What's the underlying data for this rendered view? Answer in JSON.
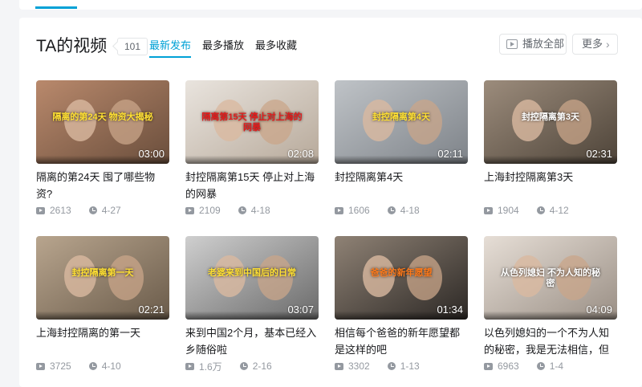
{
  "section": {
    "title": "TA的视频",
    "count": "101",
    "tabs": [
      "最新发布",
      "最多播放",
      "最多收藏"
    ],
    "active_tab": "最新发布",
    "play_all_label": "播放全部",
    "more_label": "更多"
  },
  "videos": [
    {
      "title": "隔离的第24天 囤了哪些物资?",
      "duration": "03:00",
      "views": "2613",
      "date": "4-27",
      "overlay_text": "隔离的第24天 物资大揭秘",
      "bg1": "#b9896c",
      "bg2": "#6a4e3c",
      "accent": "#ffe033"
    },
    {
      "title": "封控隔离第15天 停止对上海的网暴",
      "duration": "02:08",
      "views": "2109",
      "date": "4-18",
      "overlay_text": "隔离第15天 停止对上海的网暴",
      "bg1": "#e9e4de",
      "bg2": "#b7a99a",
      "accent": "#e21b1b"
    },
    {
      "title": "封控隔离第4天",
      "duration": "02:11",
      "views": "1606",
      "date": "4-18",
      "overlay_text": "封控隔离第4天",
      "bg1": "#bfc3c7",
      "bg2": "#7e8389",
      "accent": "#ffe033"
    },
    {
      "title": "上海封控隔离第3天",
      "duration": "02:31",
      "views": "1904",
      "date": "4-12",
      "overlay_text": "封控隔离第3天",
      "bg1": "#9c8c7c",
      "bg2": "#4e4439",
      "accent": "#ffffff"
    },
    {
      "title": "上海封控隔离的第一天",
      "duration": "02:21",
      "views": "3725",
      "date": "4-10",
      "overlay_text": "封控隔离第一天",
      "bg1": "#b8a58e",
      "bg2": "#6a5b4a",
      "accent": "#ffe033"
    },
    {
      "title": "来到中国2个月，基本已经入乡随俗啦",
      "duration": "03:07",
      "views": "1.6万",
      "date": "2-16",
      "overlay_text": "老婆来到中国后的日常",
      "bg1": "#cfcfcf",
      "bg2": "#6a6a6a",
      "accent": "#ffe033"
    },
    {
      "title": "相信每个爸爸的新年愿望都是这样的吧",
      "duration": "01:34",
      "views": "3302",
      "date": "1-13",
      "overlay_text": "爸爸的新年愿望",
      "bg1": "#8f8275",
      "bg2": "#2c2825",
      "accent": "#ff7a1a"
    },
    {
      "title": "以色列媳妇的一个不为人知的秘密，我是无法相信，但这就",
      "duration": "04:09",
      "views": "6963",
      "date": "1-4",
      "overlay_text": "从色列媳妇 不为人知的秘密",
      "bg1": "#e6ded6",
      "bg2": "#9a8f85",
      "accent": "#ffffff"
    }
  ]
}
